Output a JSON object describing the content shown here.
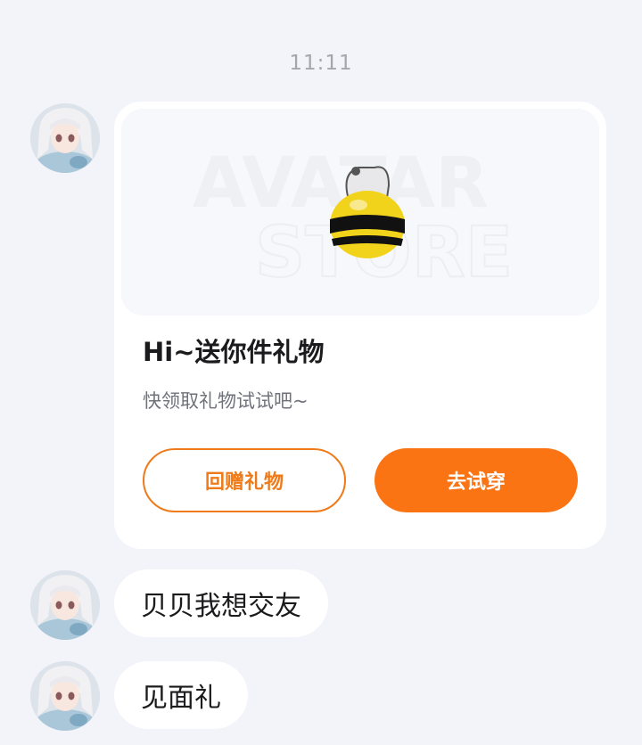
{
  "timestamp": "11:11",
  "gift_card": {
    "banner_text_line1": "AVATAR",
    "banner_text_line2": "STORE",
    "title": "Hi~送你件礼物",
    "subtitle": "快领取礼物试试吧~",
    "return_gift_label": "回赠礼物",
    "try_on_label": "去试穿",
    "accent_color": "#fb7413"
  },
  "messages": [
    {
      "text": "贝贝我想交友"
    },
    {
      "text": "见面礼"
    }
  ]
}
